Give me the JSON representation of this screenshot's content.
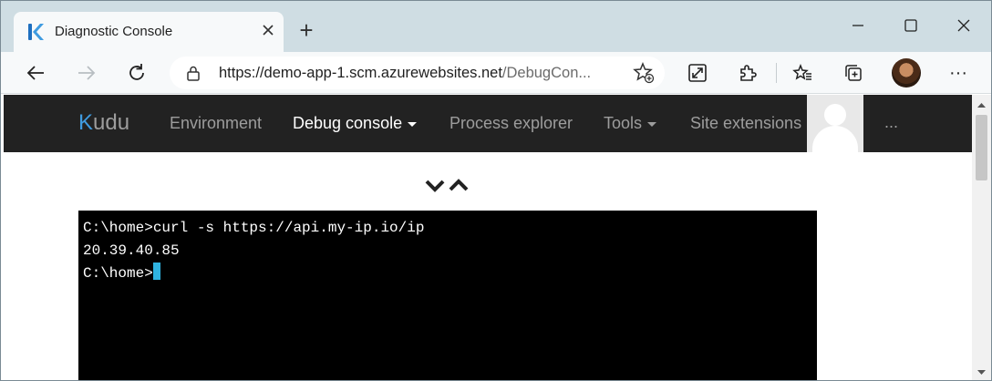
{
  "browser": {
    "tab_title": "Diagnostic Console",
    "new_tab": "+",
    "url_host": "https://demo-app-1.scm.azurewebsites.net",
    "url_rest": "/DebugCon...",
    "icons": [
      "kudu-favicon-icon",
      "close-icon",
      "plus-icon",
      "minimize-icon",
      "maximize-icon",
      "window-close-icon",
      "back-icon",
      "forward-icon",
      "refresh-icon",
      "lock-icon",
      "add-favorite-icon",
      "immersive-reader-icon",
      "extensions-icon",
      "favorites-icon",
      "collections-icon",
      "profile-avatar",
      "more-icon"
    ],
    "window_controls": {
      "minimize": "—",
      "maximize": "☐",
      "close": "✕"
    },
    "more": "···"
  },
  "kudu": {
    "brand_k": "K",
    "brand_rest": "udu",
    "nav": {
      "environment": "Environment",
      "debug_console": "Debug console",
      "process_explorer": "Process explorer",
      "tools": "Tools",
      "site_extensions": "Site extensions",
      "more": "..."
    },
    "colors": {
      "navbar": "#222222",
      "nav_text": "#9d9d9d",
      "active": "#ffffff",
      "brand_accent": "#3f9be0"
    }
  },
  "console": {
    "lines": [
      "C:\\home>curl -s https://api.my-ip.io/ip",
      "20.39.40.85",
      "C:\\home>"
    ],
    "cursor_color": "#2fb3e0"
  }
}
